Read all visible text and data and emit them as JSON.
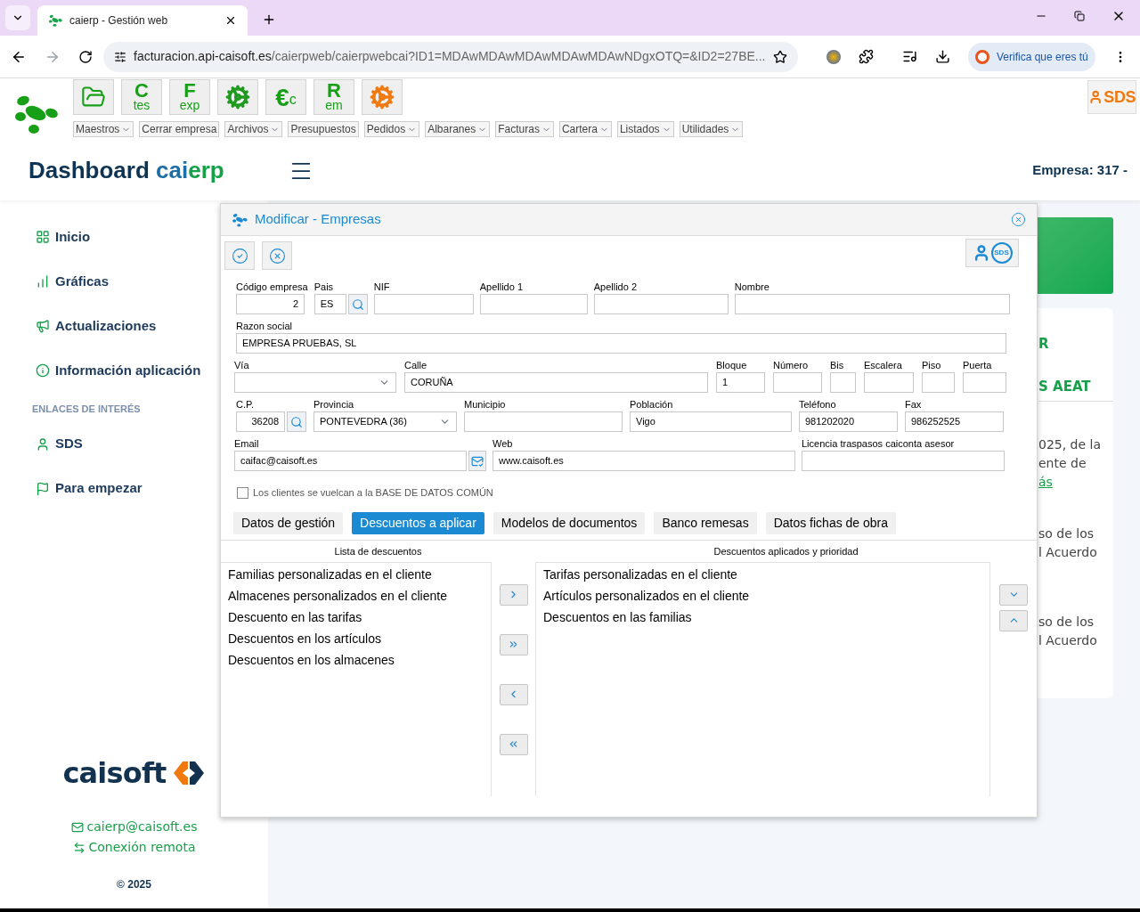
{
  "browser": {
    "tab_title": "caierp - Gestión web",
    "url_host": "facturacion.api-caisoft.es",
    "url_path": "/caierpweb/caierpwebcai?ID1=MDAwMDAwMDAwMDAwMDAwNDgxOTQ=&ID2=27BE...",
    "profile_label": "Verifica que eres tú"
  },
  "toolbar": {
    "icon_buttons": [
      {
        "kind": "folder"
      },
      {
        "kind": "letters",
        "main": "C",
        "sub": "tes"
      },
      {
        "kind": "letters",
        "main": "F",
        "sub": "exp"
      },
      {
        "kind": "gear",
        "color": "#1f9a1f"
      },
      {
        "kind": "inline",
        "main": "€",
        "sub": "c"
      },
      {
        "kind": "letters",
        "main": "R",
        "sub": "em"
      },
      {
        "kind": "gear",
        "color": "#f07a10"
      }
    ],
    "menus": [
      "Maestros",
      "Cerrar empresa",
      "Archivos",
      "Presupuestos",
      "Pedidos",
      "Albaranes",
      "Facturas",
      "Cartera",
      "Listados",
      "Utilidades"
    ],
    "menu_carets": [
      true,
      false,
      true,
      false,
      true,
      true,
      true,
      true,
      true,
      true
    ],
    "sds_label": "SDS"
  },
  "header": {
    "title": "Dashboard",
    "brand_1": "cai",
    "brand_2": "erp",
    "empresa": "Empresa: 317 -"
  },
  "sidebar": {
    "items": [
      "Inicio",
      "Gráficas",
      "Actualizaciones",
      "Información aplicación"
    ],
    "section_heading": "ENLACES DE INTERÉS",
    "links": [
      "SDS",
      "Para empezar"
    ],
    "logo_text": "caisoft",
    "email": "caierp@caisoft.es",
    "remote": "Conexión remota",
    "copyright": "© 2025"
  },
  "background_panel": {
    "fragments": [
      {
        "kind": "heading",
        "text": "R"
      },
      {
        "kind": "heading",
        "text": "S AEAT"
      },
      {
        "kind": "text",
        "text": "025, de la"
      },
      {
        "kind": "text",
        "text": "ente de"
      },
      {
        "kind": "link",
        "text": "ás"
      },
      {
        "kind": "text",
        "text": "so de los"
      },
      {
        "kind": "text",
        "text": "l Acuerdo"
      },
      {
        "kind": "text",
        "text": "so de los"
      },
      {
        "kind": "text",
        "text": "l Acuerdo"
      }
    ]
  },
  "dialog": {
    "title": "Modificar - Empresas",
    "sds_label": "SDS",
    "id_fields": [
      {
        "label": "Código empresa",
        "value": "2",
        "kind": "key"
      },
      {
        "label": "Pais",
        "value": "ES",
        "kind": "lookup"
      },
      {
        "label": "NIF",
        "kind": "text"
      },
      {
        "label": "Apellido 1",
        "kind": "text"
      },
      {
        "label": "Apellido 2",
        "kind": "text"
      },
      {
        "label": "Nombre",
        "kind": "text"
      }
    ],
    "company_name": [
      {
        "label": "Razon social",
        "value": "EMPRESA PRUEBAS, SL",
        "kind": "text"
      }
    ],
    "address_fields": [
      {
        "label": "Vía",
        "kind": "select"
      },
      {
        "label": "Calle",
        "value": "CORUÑA",
        "kind": "text"
      },
      {
        "label": "Bloque",
        "value": "1",
        "kind": "text"
      },
      {
        "label": "Número",
        "kind": "text"
      },
      {
        "label": "Bis",
        "kind": "text"
      },
      {
        "label": "Escalera",
        "kind": "text"
      },
      {
        "label": "Piso",
        "kind": "text"
      },
      {
        "label": "Puerta",
        "kind": "text"
      }
    ],
    "location_fields": [
      {
        "label": "C.P.",
        "value": "36208",
        "kind": "zip"
      },
      {
        "label": "Provincia",
        "value": "PONTEVEDRA (36)",
        "kind": "select"
      },
      {
        "label": "Municipio",
        "kind": "text"
      },
      {
        "label": "Población",
        "value": "Vigo",
        "kind": "text"
      },
      {
        "label": "Teléfono",
        "value": "981202020",
        "kind": "text"
      },
      {
        "label": "Fax",
        "value": "986252525",
        "kind": "text"
      }
    ],
    "contact_fields": [
      {
        "label": "Email",
        "value": "caifac@caisoft.es",
        "kind": "email"
      },
      {
        "label": "Web",
        "value": "www.caisoft.es",
        "kind": "text"
      },
      {
        "label": "Licencia traspasos caiconta asesor",
        "kind": "text"
      }
    ],
    "checkbox": {
      "label": "Los clientes se vuelcan a la BASE DE DATOS COMÚN",
      "checked": false
    },
    "tabs": [
      {
        "label": "Datos de gestión",
        "selected": false
      },
      {
        "label": "Descuentos a aplicar",
        "selected": true
      },
      {
        "label": "Modelos de documentos",
        "selected": false
      },
      {
        "label": "Banco remesas",
        "selected": false
      },
      {
        "label": "Datos fichas de obra",
        "selected": false
      }
    ],
    "available": {
      "title": "Lista de descuentos",
      "items": [
        "Familias personalizadas en el cliente",
        "Almacenes personalizados en el cliente",
        "Descuento en las tarifas",
        "Descuentos en los artículos",
        "Descuentos en los almacenes"
      ]
    },
    "applied": {
      "title": "Descuentos aplicados y prioridad",
      "items": [
        "Tarifas personalizadas en el cliente",
        "Artículos personalizados en el cliente",
        "Descuentos en las familias"
      ]
    }
  }
}
